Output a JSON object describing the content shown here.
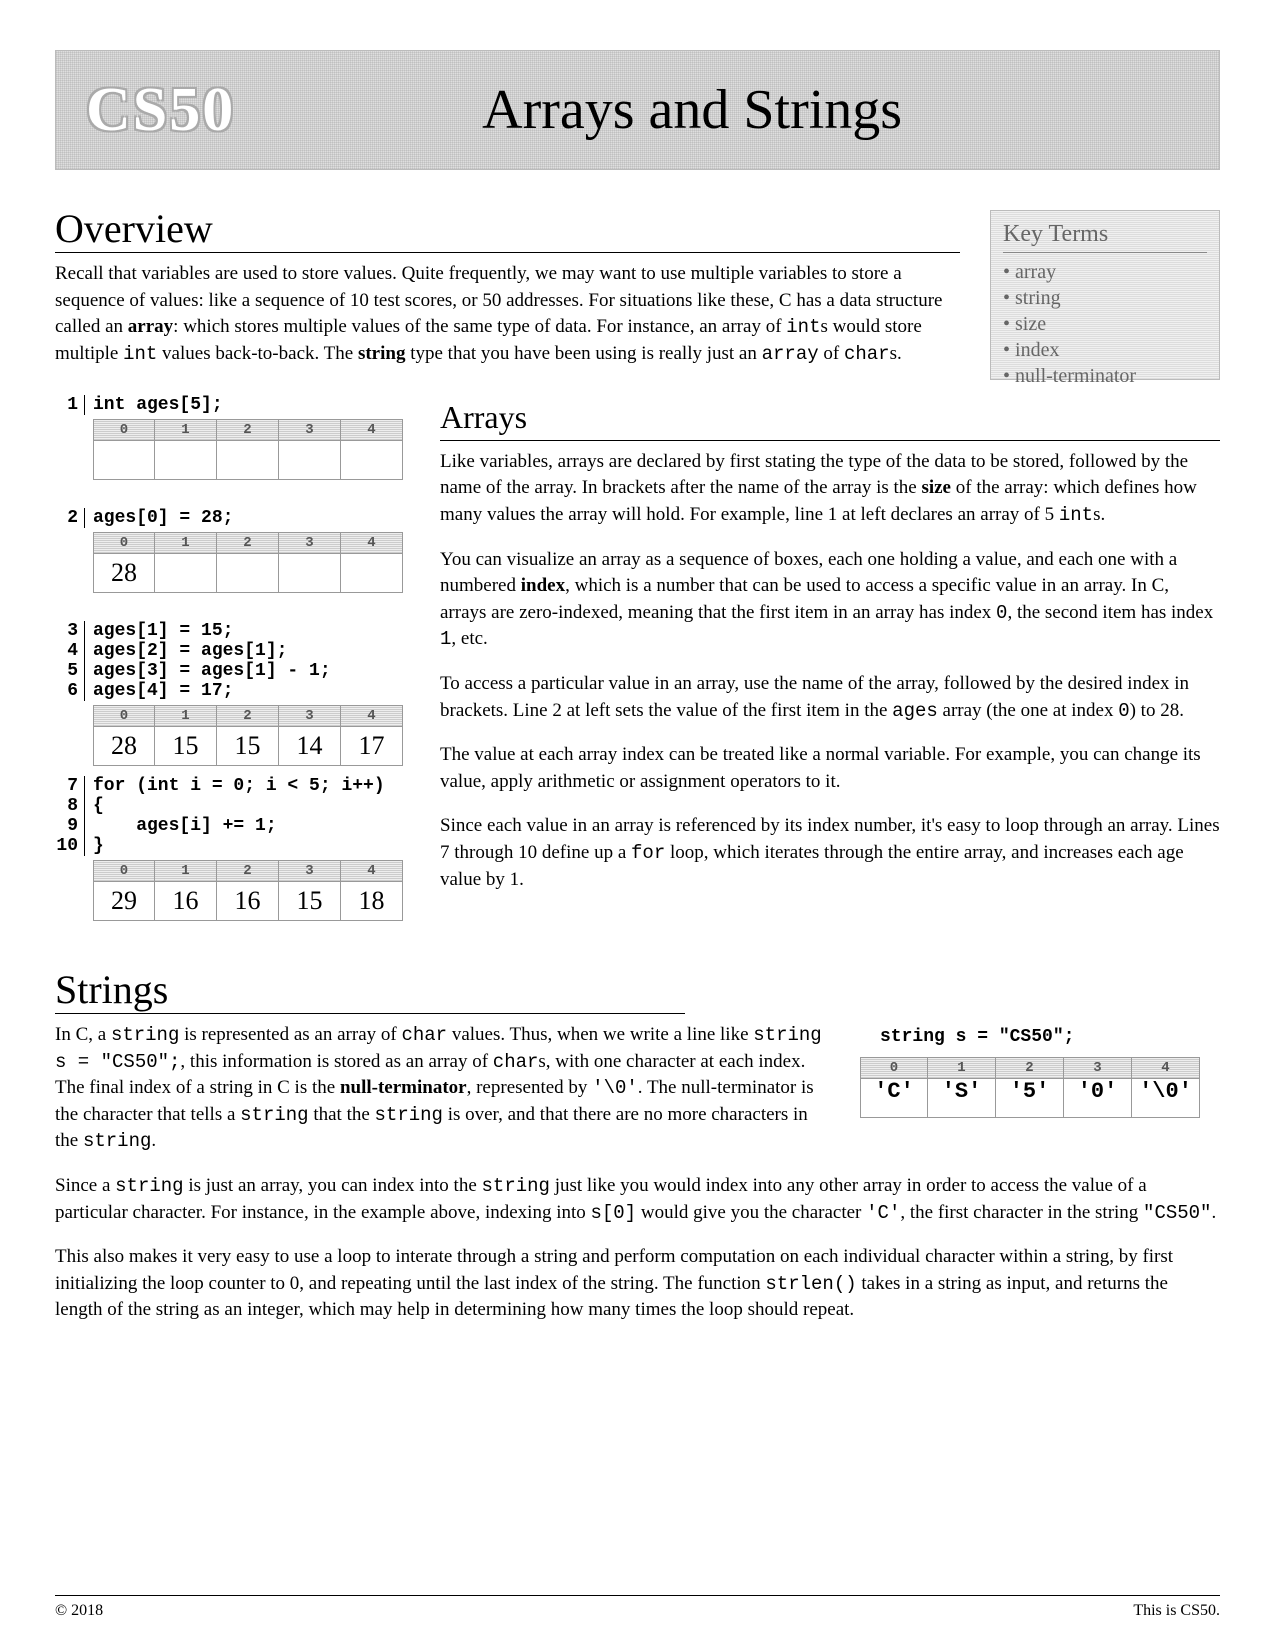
{
  "banner": {
    "logo": "CS50",
    "title": "Arrays and Strings"
  },
  "overview": {
    "heading": "Overview",
    "text_pre": "Recall that variables are used to store values. Quite frequently, we may want to use multiple variables to store a sequence of values: like a sequence of 10 test scores, or 50 addresses. For situations like these, C has a data structure called an ",
    "bold1": "array",
    "text_mid": ": which stores multiple values of the same type of data. For instance, an array of ",
    "mono1": "int",
    "text_mid2": "s would store multiple ",
    "mono2": "int",
    "text_mid3": " values back-to-back. The ",
    "bold2": "string",
    "text_mid4": " type that you have been using is really just an ",
    "mono3": "array",
    "text_mid5": " of ",
    "mono4": "char",
    "text_end": "s."
  },
  "key_terms": {
    "title": "Key Terms",
    "items": [
      "array",
      "string",
      "size",
      "index",
      "null-terminator"
    ]
  },
  "code": {
    "l1": "int ages[5];",
    "l2": "ages[0] = 28;",
    "l3": "ages[1] = 15;",
    "l4": "ages[2] = ages[1];",
    "l5": "ages[3] = ages[1] - 1;",
    "l6": "ages[4] = 17;",
    "l7": "for (int i = 0; i < 5; i++)",
    "l8": "{",
    "l9": "    ages[i] += 1;",
    "l10": "}"
  },
  "arrays_heading": "Arrays",
  "arrays_p1_a": "Like variables, arrays are declared by first stating the type of the data to be stored, followed by the name of the array. In brackets after the name of the array is the ",
  "arrays_p1_b": "size",
  "arrays_p1_c": " of the array: which defines how many values the array will hold. For example, line 1 at left declares an array of 5 ",
  "arrays_p1_d": "int",
  "arrays_p1_e": "s.",
  "arrays_p2_a": "You can visualize an array as a sequence of boxes, each one holding a value, and each one with a numbered ",
  "arrays_p2_b": "index",
  "arrays_p2_c": ", which is a number that can be used to access a specific value in an array. In C, arrays are zero-indexed, meaning that the first item in an array has index ",
  "arrays_p2_d": "0",
  "arrays_p2_e": ", the second item has index ",
  "arrays_p2_f": "1",
  "arrays_p2_g": ", etc.",
  "arrays_p3_a": "To access a particular value in an array, use the name of the array, followed by the desired index in brackets. Line 2 at left sets the value of the first item in the ",
  "arrays_p3_b": "ages",
  "arrays_p3_c": " array (the one at index ",
  "arrays_p3_d": "0",
  "arrays_p3_e": ") to 28.",
  "arrays_p4": "The value at each array index can be treated like a normal variable. For example, you can change its value, apply arithmetic or assignment operators to it.",
  "arrays_p5_a": "Since each value in an array is referenced by its index number, it's easy to loop through an array. Lines 7 through 10 define up a ",
  "arrays_p5_b": "for",
  "arrays_p5_c": " loop, which iterates through the entire array, and increases each age value by 1.",
  "arr1_vals": [
    "",
    "",
    "",
    "",
    ""
  ],
  "arr2_vals": [
    "28",
    "",
    "",
    "",
    ""
  ],
  "arr3_vals": [
    "28",
    "15",
    "15",
    "14",
    "17"
  ],
  "arr4_vals": [
    "29",
    "16",
    "16",
    "15",
    "18"
  ],
  "indices": [
    "0",
    "1",
    "2",
    "3",
    "4"
  ],
  "strings": {
    "heading": "Strings",
    "p1_a": "In C, a ",
    "p1_b": "string",
    "p1_c": " is represented as an array of ",
    "p1_d": "char",
    "p1_e": " values. Thus, when we write a line like ",
    "p1_f": "string s = \"CS50\";",
    "p1_g": ", this information is stored as an array of ",
    "p1_h": "char",
    "p1_i": "s, with one character at each index. The final index of a string in C is the ",
    "p1_j": "null-terminator",
    "p1_k": ", represented by ",
    "p1_l": "'\\0'",
    "p1_m": ". The null-terminator is the character that tells a ",
    "p1_n": "string",
    "p1_o": " that the ",
    "p1_p": "string",
    "p1_q": " is over, and that there are no more characters in the ",
    "p1_r": "string",
    "p1_s": ".",
    "p2_a": "Since a ",
    "p2_b": "string",
    "p2_c": " is just an array, you can index into the ",
    "p2_d": "string",
    "p2_e": " just like you would index into any other array in order to access the value of a particular character. For instance, in the example above, indexing into ",
    "p2_f": "s[0]",
    "p2_g": " would give you the character ",
    "p2_h": "'C'",
    "p2_i": ", the first character in the string ",
    "p2_j": "\"CS50\"",
    "p2_k": ".",
    "p3_a": "This also makes it very easy to use a loop to interate through a string and perform computation on each individual character within a string, by first initializing the loop counter to 0, and repeating until the last index of the string. The function ",
    "p3_b": "strlen()",
    "p3_c": " takes in a string as input, and returns the length of the string as an integer, which may help in determining how many times the loop should repeat.",
    "fig_code": "string s = \"CS50\";",
    "fig_vals": [
      "'C'",
      "'S'",
      "'5'",
      "'0'",
      "'\\0'"
    ]
  },
  "footer": {
    "left": "© 2018",
    "right": "This is CS50."
  }
}
